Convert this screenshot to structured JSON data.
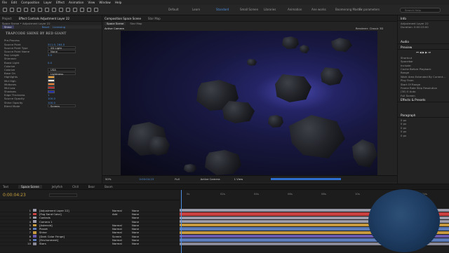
{
  "menu": [
    "File",
    "Edit",
    "Composition",
    "Layer",
    "Effect",
    "Animation",
    "View",
    "Window",
    "Help"
  ],
  "workspaces": [
    "Default",
    "Learn",
    "Standard",
    "Small Screen",
    "Libraries",
    "Animation",
    "Ane works",
    "Boomerang Master",
    "Fx parameters"
  ],
  "active_workspace": "Standard",
  "search_placeholder": "Search Help",
  "left_panel": {
    "tabs": [
      "Project",
      "Effect Controls Adjustment Layer 22"
    ],
    "breadcrumb": "Space Scene • Adjustment Layer 22",
    "effect_name": "Shine",
    "effect_links": [
      "Reset",
      "Licensing"
    ],
    "brand": "TRAPCODE SHINE BY RED GIANT",
    "rows": [
      {
        "k": "Pre-Process",
        "v": ""
      },
      {
        "k": "Source Point",
        "v": "511.0, 264.0"
      },
      {
        "k": "Source Point Type",
        "v": "2D Light"
      },
      {
        "k": "Source Point Name",
        "v": "None"
      },
      {
        "k": "Ray Length",
        "v": "3.0"
      },
      {
        "k": "Shimmer",
        "v": ""
      },
      {
        "k": "Boost Light",
        "v": "0.0"
      },
      {
        "k": "Colorize",
        "v": ""
      },
      {
        "k": "Colorize",
        "v": "USA"
      },
      {
        "k": "Base On",
        "v": "Lightness"
      },
      {
        "k": "Highlights",
        "v": ""
      },
      {
        "k": "Mid High",
        "v": ""
      },
      {
        "k": "Midtones",
        "v": ""
      },
      {
        "k": "Mid Low",
        "v": ""
      },
      {
        "k": "Shadows",
        "v": ""
      },
      {
        "k": "Edge Thickness",
        "v": "1"
      },
      {
        "k": "Source Opacity",
        "v": "100.0"
      },
      {
        "k": "Shine Opacity",
        "v": "100.0"
      },
      {
        "k": "Blend Mode",
        "v": "Screen"
      }
    ],
    "swatches": [
      "#f0a030",
      "#f6f0e0",
      "#e87a2a",
      "#c22a2a",
      "#1a2ab4"
    ]
  },
  "viewer": {
    "tabs": [
      "Composition Space Scene",
      "Star Map"
    ],
    "sub_tabs": [
      "Space Scene",
      "Star Map"
    ],
    "label": "Active Camera",
    "renderer": "Renderer: Classic 3D",
    "zoom": "50%",
    "timecode": "0:00:04:23",
    "quality": "Full",
    "camera": "Active Camera",
    "views": "1 View"
  },
  "right_panel": {
    "info_title": "Info",
    "info_lines": [
      "Adjustment Layer 22",
      "Duration: 0:00:15:00"
    ],
    "audio_title": "Audio",
    "preview_title": "Preview",
    "preview_rows": [
      "Shortcut",
      "Spacebar",
      "Include:",
      "Cache Before Playback",
      "Range",
      "Work Area Extended By Current...",
      "Play From",
      "Start Of Range",
      "Frame Rate   Skip   Resolution",
      "(30)   0   Auto",
      "Full Screen"
    ],
    "effects_title": "Effects & Presets",
    "paragraph_title": "Paragraph",
    "para_values": [
      "0 px",
      "0 px",
      "0 px",
      "0 px",
      "0 px"
    ]
  },
  "timeline": {
    "tabs": [
      "Text",
      "Space Scene",
      "Jellyfish",
      "Chill",
      "Bear",
      "Boom"
    ],
    "active_tab": "Space Scene",
    "timecode": "0:00:04:23",
    "columns": [
      "Layer Name",
      "Mode",
      "T TrkMat",
      "Parent & Link"
    ],
    "ticks": [
      "0s",
      "02s",
      "04s",
      "06s",
      "08s",
      "10s",
      "12s",
      "14s"
    ],
    "layers": [
      {
        "n": "1",
        "name": "[Adjustment Layer 22]",
        "mode": "Normal",
        "trk": "None",
        "color": "#9a9aa8"
      },
      {
        "n": "2",
        "name": "[Fog Sand Color]",
        "mode": "Add",
        "trk": "None",
        "color": "#c84040"
      },
      {
        "n": "3",
        "name": "Controls",
        "mode": "",
        "trk": "None",
        "color": "#9a9aa8"
      },
      {
        "n": "4",
        "name": "Camera 1",
        "mode": "",
        "trk": "None",
        "color": "#9a9aa8"
      },
      {
        "n": "5",
        "name": "[Asteroid]",
        "mode": "Normal",
        "trk": "None",
        "color": "#c89a40"
      },
      {
        "n": "6",
        "name": "Planet",
        "mode": "Normal",
        "trk": "None",
        "color": "#5a7ab8"
      },
      {
        "n": "7",
        "name": "Shine",
        "mode": "Normal",
        "trk": "None",
        "color": "#c89a40"
      },
      {
        "n": "8",
        "name": "[Dark Color Fringe]",
        "mode": "Screen",
        "trk": "None",
        "color": "#6a5ab0"
      },
      {
        "n": "9",
        "name": "[Environment]",
        "mode": "Normal",
        "trk": "None",
        "color": "#5a7ab8"
      },
      {
        "n": "10",
        "name": "Stars",
        "mode": "Normal",
        "trk": "None",
        "color": "#8a8a98"
      }
    ]
  }
}
